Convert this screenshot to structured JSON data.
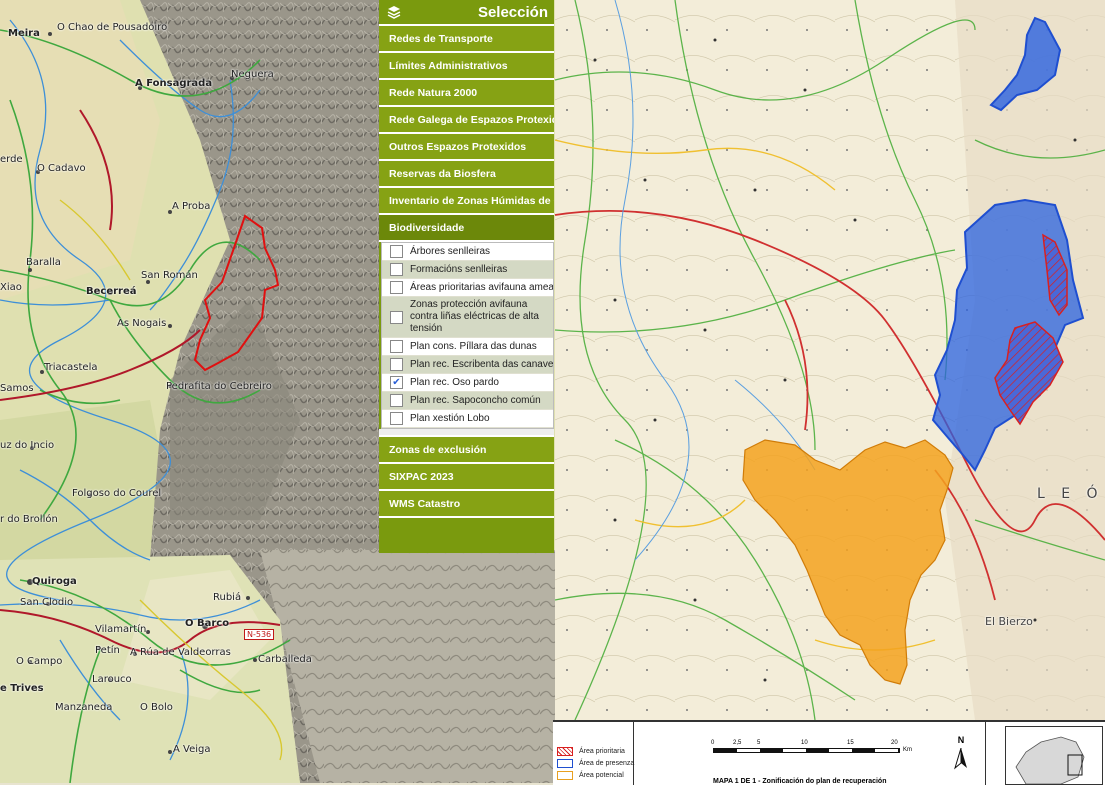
{
  "left_map": {
    "places": [
      {
        "key": "meira",
        "label": "Meira"
      },
      {
        "key": "chao",
        "label": "O Chao de Pousadoiro"
      },
      {
        "key": "fonsagrada",
        "label": "A Fonsagrada"
      },
      {
        "key": "neguera",
        "label": "Neguera"
      },
      {
        "key": "erde",
        "label": "erde"
      },
      {
        "key": "cadavo",
        "label": "O Cadavo"
      },
      {
        "key": "proba",
        "label": "A Proba"
      },
      {
        "key": "baralla",
        "label": "Baralla"
      },
      {
        "key": "xiao",
        "label": "Xiao"
      },
      {
        "key": "becerrea",
        "label": "Becerreá"
      },
      {
        "key": "sanroman",
        "label": "San Román"
      },
      {
        "key": "nogais",
        "label": "As Nogais"
      },
      {
        "key": "triacastela",
        "label": "Triacastela"
      },
      {
        "key": "samos",
        "label": "Samos"
      },
      {
        "key": "pedrafita",
        "label": "Pedrafita do Cebreiro"
      },
      {
        "key": "incio",
        "label": "uz do Incio"
      },
      {
        "key": "folgoso",
        "label": "Folgoso do Courel"
      },
      {
        "key": "brollon",
        "label": "r do Brollón"
      },
      {
        "key": "quiroga",
        "label": "Quiroga"
      },
      {
        "key": "sanclodio",
        "label": "San Clodio"
      },
      {
        "key": "rubia",
        "label": "Rubiá"
      },
      {
        "key": "vilamartin",
        "label": "Vilamartín"
      },
      {
        "key": "obarco",
        "label": "O Barco"
      },
      {
        "key": "petin",
        "label": "Petín"
      },
      {
        "key": "arua",
        "label": "A Rúa de Valdeorras"
      },
      {
        "key": "ocampo",
        "label": "O Campo"
      },
      {
        "key": "carballeda",
        "label": "Carballeda"
      },
      {
        "key": "trives",
        "label": "e Trives"
      },
      {
        "key": "larouco",
        "label": "Larouco"
      },
      {
        "key": "manzaneda",
        "label": "Manzaneda"
      },
      {
        "key": "obolo",
        "label": "O Bolo"
      },
      {
        "key": "aveiga",
        "label": "A Veiga"
      }
    ],
    "road_shield": "N-536"
  },
  "selection_panel": {
    "title": "Selección",
    "categories_top": [
      "Redes de Transporte",
      "Límites Administrativos",
      "Rede Natura 2000",
      "Rede Galega de Espazos Protexidos",
      "Outros Espazos Protexidos",
      "Reservas da Biosfera",
      "Inventario de Zonas Húmidas de Galicia"
    ],
    "open_category": "Biodiversidade",
    "biodiversity_items": [
      {
        "label": "Árbores senlleiras",
        "checked": false
      },
      {
        "label": "Formacións senlleiras",
        "checked": false
      },
      {
        "label": "Áreas prioritarias avifauna ameazada",
        "checked": false
      },
      {
        "label": "Zonas protección avifauna contra liñas eléctricas de alta tensión",
        "checked": false
      },
      {
        "label": "Plan cons. Píllara das dunas",
        "checked": false
      },
      {
        "label": "Plan rec. Escribenta das canaveiras",
        "checked": false
      },
      {
        "label": "Plan rec. Oso pardo",
        "checked": true
      },
      {
        "label": "Plan rec. Sapoconcho común",
        "checked": false
      },
      {
        "label": "Plan xestión Lobo",
        "checked": false
      }
    ],
    "categories_bottom": [
      "Zonas de exclusión",
      "SIXPAC 2023",
      "WMS Catastro"
    ]
  },
  "right_map": {
    "labels": {
      "leon": "L E Ó",
      "bierzo": "El Bierzo"
    },
    "colors": {
      "presence": "#2a62e0",
      "potential": "#f3a21e",
      "priority": "#d82020"
    }
  },
  "legend": {
    "items": [
      {
        "label": "Área prioritaria",
        "color": "#d82020"
      },
      {
        "label": "Área de presenza",
        "color": "#1f4fd0"
      },
      {
        "label": "Área potencial",
        "color": "#e8a020"
      }
    ],
    "scale_ticks": [
      "0",
      "2,5",
      "5",
      "10",
      "15",
      "20"
    ],
    "scale_unit": "Km",
    "map_title": "MAPA 1 DE 1 - Zonificación do plan de recuperación",
    "north": "N"
  }
}
